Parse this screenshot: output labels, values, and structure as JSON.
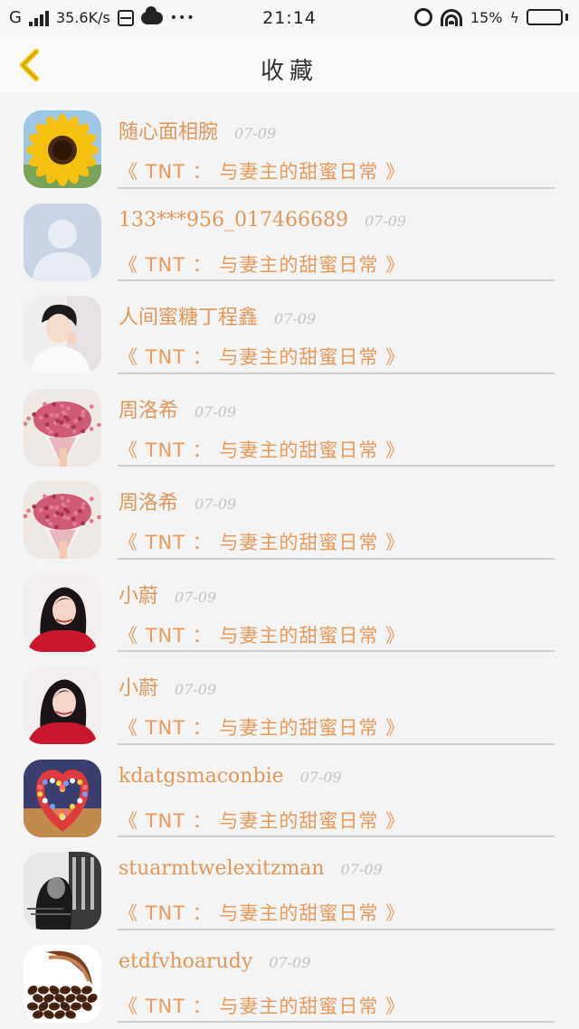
{
  "status_bar": {
    "network": "G",
    "speed": "35.6K/s",
    "overflow": "•••",
    "time": "21:14",
    "battery": "15%",
    "battery_level": 0.15,
    "icons": [
      "signal-icon",
      "database-icon",
      "cloud-icon",
      "alarm-icon",
      "wifi-icon",
      "charging-icon",
      "battery-icon"
    ]
  },
  "header": {
    "title": "收藏",
    "back_icon": "chevron-left-icon",
    "accent": "#f2c200"
  },
  "colors": {
    "name": "#e1975a",
    "book": "#ea9a5b",
    "date": "#c4c4c4",
    "separator": "#cfcfcf"
  },
  "items": [
    {
      "name": "随心面相腕",
      "date": "07-09",
      "book": "《 TNT ： 与妻主的甜蜜日常 》",
      "avatar": "sunflower"
    },
    {
      "name": "133***956_017466689",
      "date": "07-09",
      "book": "《 TNT ： 与妻主的甜蜜日常 》",
      "avatar": "default-user"
    },
    {
      "name": "人间蜜糖丁程鑫",
      "date": "07-09",
      "book": "《 TNT ： 与妻主的甜蜜日常 》",
      "avatar": "boy-photo"
    },
    {
      "name": "周洛希",
      "date": "07-09",
      "book": "《 TNT ： 与妻主的甜蜜日常 》",
      "avatar": "pink-bouquet"
    },
    {
      "name": "周洛希",
      "date": "07-09",
      "book": "《 TNT ： 与妻主的甜蜜日常 》",
      "avatar": "pink-bouquet"
    },
    {
      "name": "小蔚",
      "date": "07-09",
      "book": "《 TNT ： 与妻主的甜蜜日常 》",
      "avatar": "girl-red"
    },
    {
      "name": "小蔚",
      "date": "07-09",
      "book": "《 TNT ： 与妻主的甜蜜日常 》",
      "avatar": "girl-red"
    },
    {
      "name": "kdatgsmaconbie",
      "date": "07-09",
      "book": "《 TNT ： 与妻主的甜蜜日常 》",
      "avatar": "heart-lights"
    },
    {
      "name": "stuarmtwelexitzman",
      "date": "07-09",
      "book": "《 TNT ： 与妻主的甜蜜日常 》",
      "avatar": "bw-portrait"
    },
    {
      "name": "etdfvhoarudy",
      "date": "07-09",
      "book": "《 TNT ： 与妻主的甜蜜日常 》",
      "avatar": "coffee-beans"
    }
  ]
}
